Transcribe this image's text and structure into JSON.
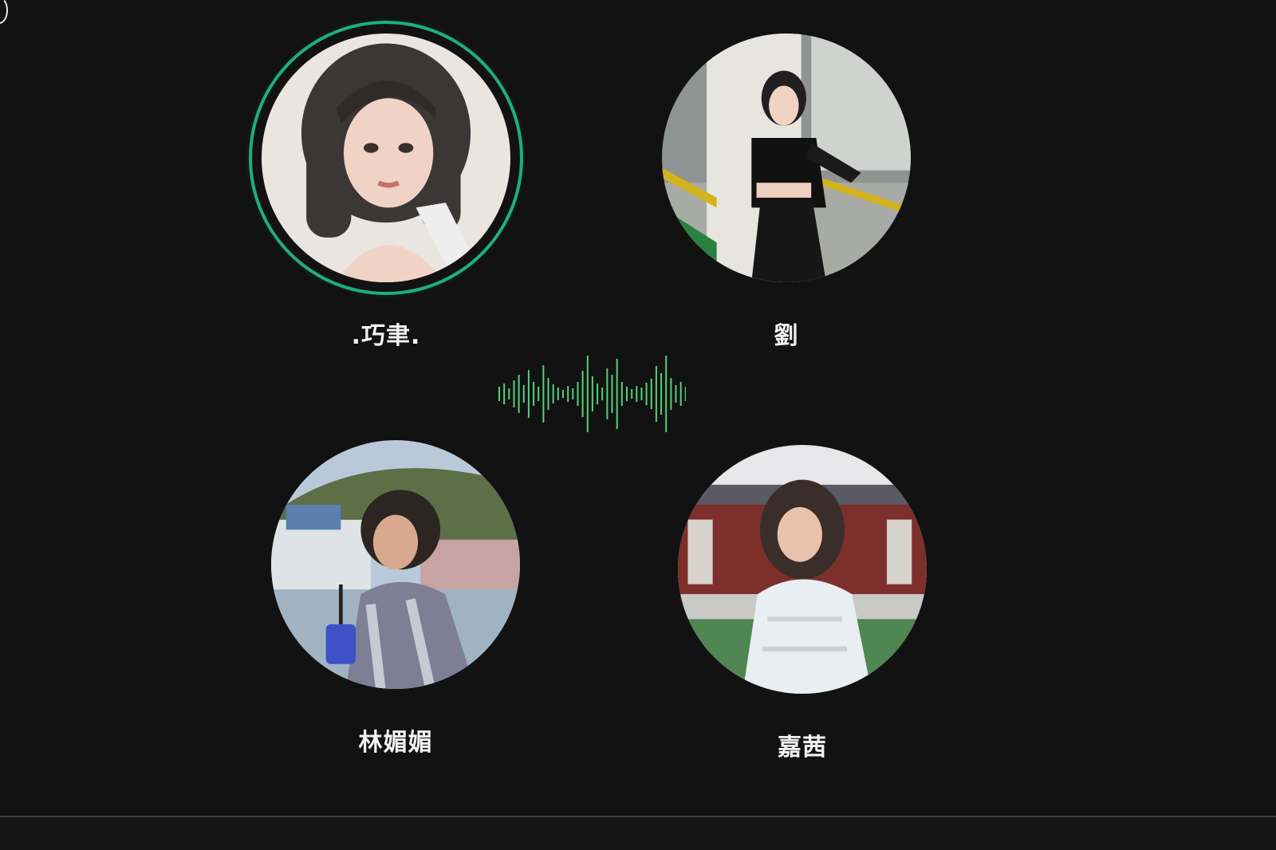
{
  "call": {
    "participants": [
      {
        "name": ".巧聿.",
        "speaking": true,
        "avatar_icon": "portrait-photo"
      },
      {
        "name": "劉",
        "speaking": false,
        "avatar_icon": "portrait-photo"
      },
      {
        "name": "林媚媚",
        "speaking": false,
        "avatar_icon": "portrait-photo"
      },
      {
        "name": "嘉茜",
        "speaking": false,
        "avatar_icon": "portrait-photo"
      }
    ],
    "audio_indicator": {
      "icon": "sound-wave-icon",
      "color": "#55d17a"
    }
  },
  "colors": {
    "background": "#121212",
    "speaking_ring": "#1fae7f",
    "name_text": "#f2f2f2",
    "divider": "#3a4246"
  }
}
